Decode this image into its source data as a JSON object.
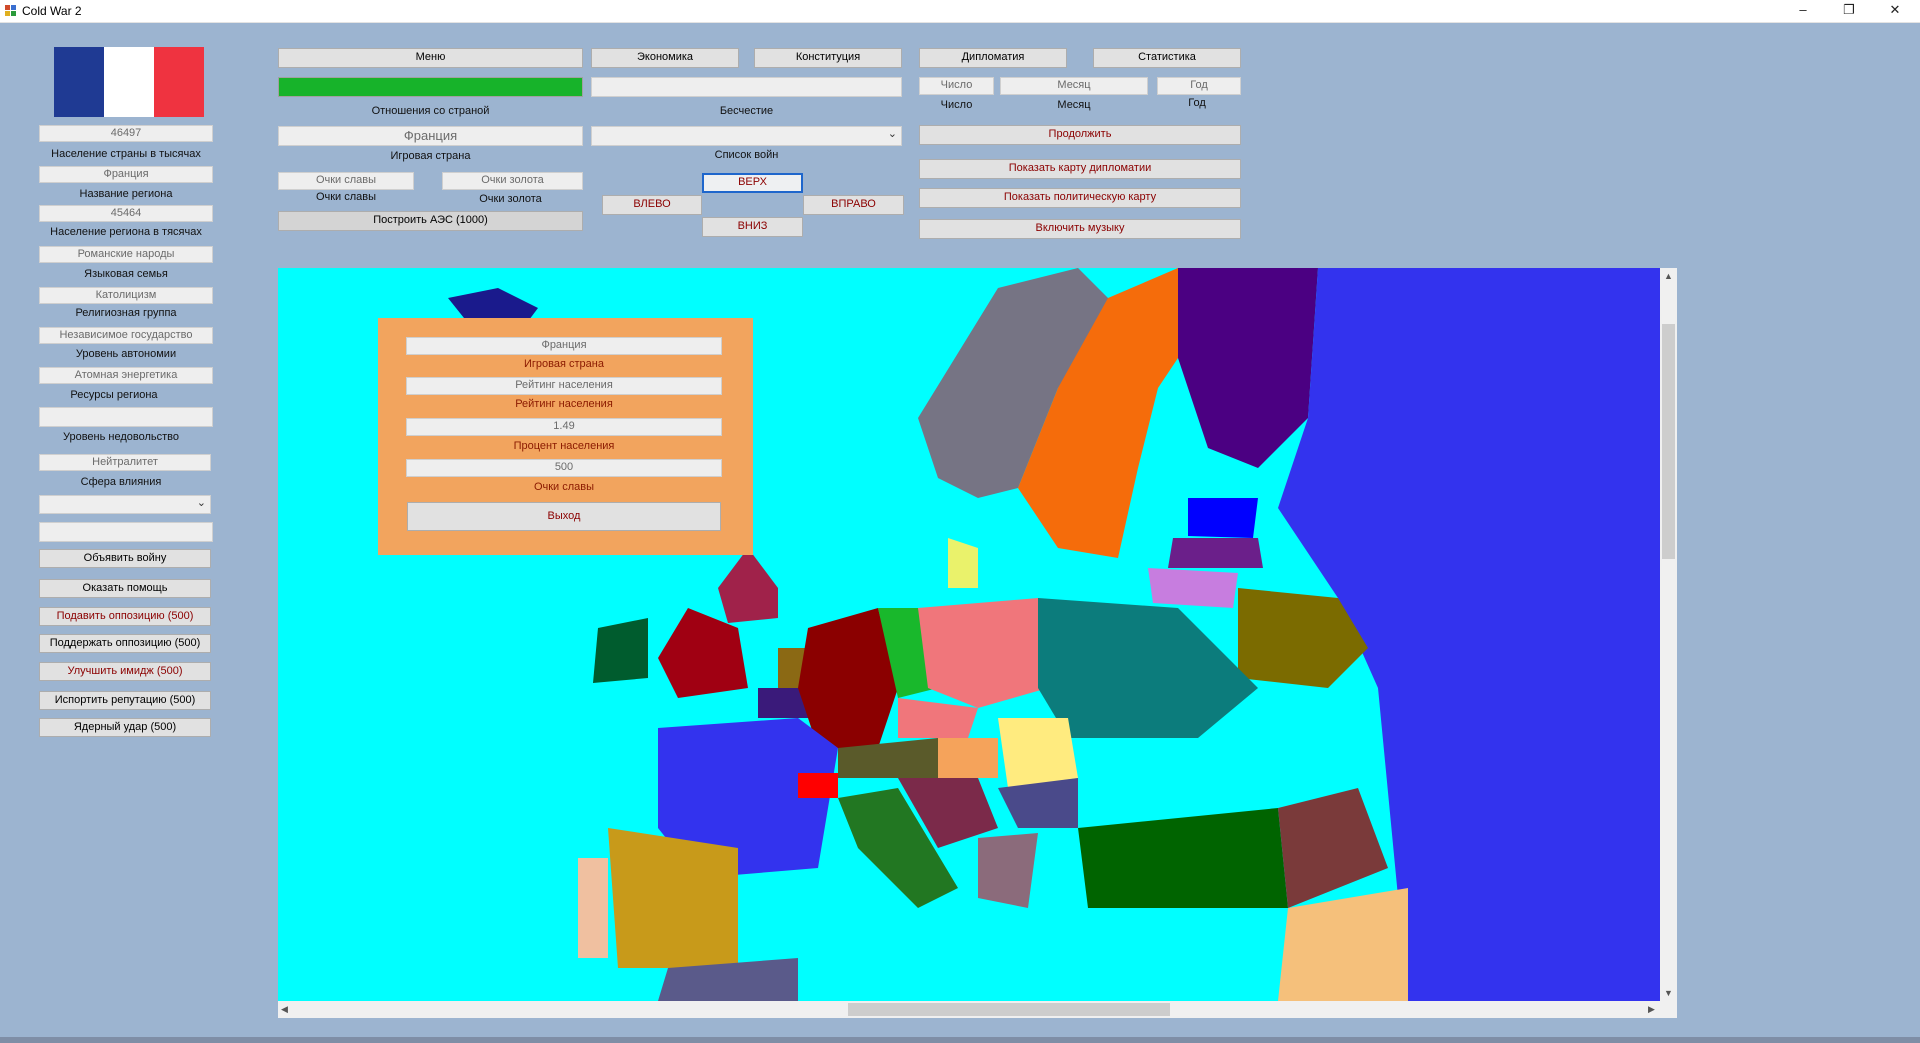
{
  "window": {
    "title": "Cold War 2",
    "minimize": "–",
    "maximize": "❐",
    "close": "✕"
  },
  "flag": {
    "colors": [
      "#1f3a93",
      "#ffffff",
      "#ef3340"
    ]
  },
  "left": {
    "population_value": "46497",
    "population_label": "Население страны в тысячах",
    "region_name_value": "Франция",
    "region_name_label": "Название региона",
    "region_pop_value": "45464",
    "region_pop_label": "Население региона в тясячах",
    "language_value": "Романские народы",
    "language_label": "Языковая семья",
    "religion_value": "Католицизм",
    "religion_label": "Религиозная группа",
    "autonomy_value": "Независимое государство",
    "autonomy_label": "Уровень автономии",
    "resources_value": "Атомная энергетика",
    "resources_label": "Ресурсы региона",
    "discontent_value": "",
    "discontent_label": "Уровень недовольство",
    "sphere_value": "Нейтралитет",
    "sphere_label": "Сфера влияния",
    "select_value": "",
    "extra_field": "",
    "buttons": {
      "declare_war": "Объявить войну",
      "help": "Оказать помощь",
      "suppress": "Подавить оппозицию (500)",
      "support": "Поддержать оппозицию (500)",
      "image": "Улучшить имидж (500)",
      "reputation": "Испортить репутацию (500)",
      "nuke": "Ядерный удар (500)"
    }
  },
  "top": {
    "menu": "Меню",
    "economy": "Экономика",
    "constitution": "Конституция",
    "diplomacy": "Дипломатия",
    "statistics": "Статистика",
    "relations_label": "Отношения со страной",
    "dishonor_field": "",
    "dishonor_label": "Бесчестие",
    "country_value": "Франция",
    "country_label": "Игровая страна",
    "wars_select": "",
    "wars_label": "Список войн",
    "glory_field": "Очки славы",
    "glory_label": "Очки славы",
    "gold_field": "Очки золота",
    "gold_label": "Очки золота",
    "build_npp": "Построить АЭС (1000)",
    "up": "ВЕРХ",
    "left": "ВЛЕВО",
    "right": "ВПРАВО",
    "down": "ВНИЗ",
    "day_field": "Число",
    "month_field": "Месяц",
    "year_field": "Год",
    "day_label": "Число",
    "month_label": "Месяц",
    "year_label": "Год",
    "continue": "Продолжить",
    "diplomacy_map": "Показать карту дипломатии",
    "political_map": "Показать политическую карту",
    "music": "Включить музыку",
    "relations_bar_color": "#17b32a"
  },
  "popup": {
    "country_value": "Франция",
    "country_label": "Игровая страна",
    "rating_value": "Рейтинг населения",
    "rating_label": "Рейтинг населения",
    "percent_value": "1.49",
    "percent_label": "Процент населения",
    "glory_value": "500",
    "glory_label": "Очки славы",
    "exit": "Выход"
  },
  "map": {
    "sea_color": "#00ffff",
    "land_color": "#3333ee"
  }
}
